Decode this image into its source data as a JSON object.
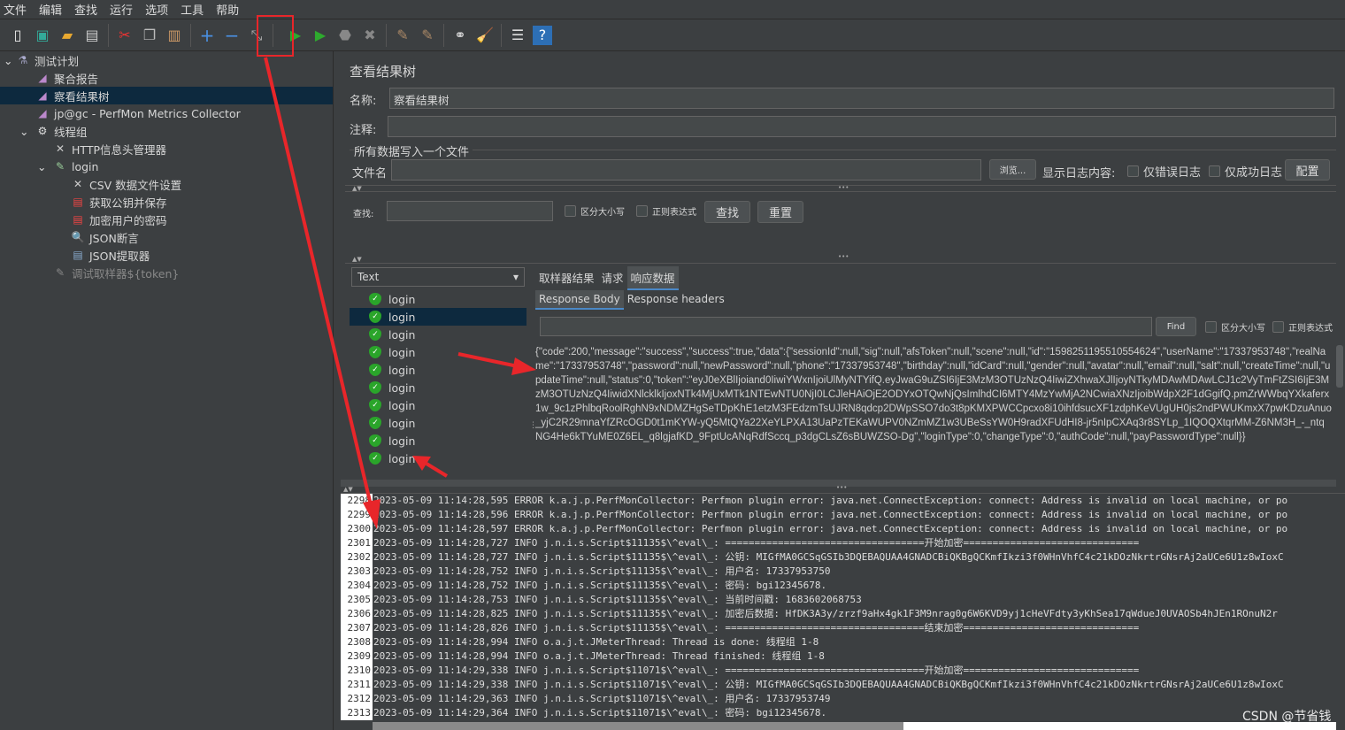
{
  "menu": [
    "文件",
    "编辑",
    "查找",
    "运行",
    "选项",
    "工具",
    "帮助"
  ],
  "toolbar": [
    "new-icon",
    "templates-icon",
    "open-icon",
    "save-icon",
    "cut-icon",
    "copy-icon",
    "paste-icon",
    "expand-icon",
    "collapse-icon",
    "toggle-icon",
    "start-icon",
    "start-no-pause-icon",
    "stop-icon",
    "shutdown-icon",
    "clear-icon",
    "clear-all-icon",
    "search-icon",
    "reset-search-icon",
    "function-helper-icon",
    "help-icon"
  ],
  "tree": {
    "items": [
      {
        "label": "测试计划",
        "icon": "test-plan-icon"
      },
      {
        "label": "聚合报告",
        "icon": "listener-icon"
      },
      {
        "label": "察看结果树",
        "icon": "listener-icon"
      },
      {
        "label": "jp@gc - PerfMon Metrics Collector",
        "icon": "listener-icon"
      },
      {
        "label": "线程组",
        "icon": "gear-icon"
      },
      {
        "label": "HTTP信息头管理器",
        "icon": "config-icon"
      },
      {
        "label": "login",
        "icon": "sampler-icon"
      },
      {
        "label": "CSV 数据文件设置",
        "icon": "config-icon"
      },
      {
        "label": "获取公钥并保存",
        "icon": "script-icon"
      },
      {
        "label": "加密用户的密码",
        "icon": "script-icon"
      },
      {
        "label": "JSON断言",
        "icon": "assertion-icon"
      },
      {
        "label": "JSON提取器",
        "icon": "extractor-icon"
      },
      {
        "label": "调试取样器${token}",
        "icon": "sampler-icon"
      }
    ]
  },
  "panel": {
    "title": "查看结果树",
    "name_label": "名称:",
    "name_value": "察看结果树",
    "comment_label": "注释:",
    "file_section": "所有数据写入一个文件",
    "filename_label": "文件名",
    "browse": "浏览...",
    "log_content_label": "显示日志内容:",
    "errors_only": "仅错误日志",
    "success_only": "仅成功日志",
    "configure": "配置",
    "search_label": "查找:",
    "case_sensitive": "区分大小写",
    "regex": "正则表达式",
    "search_btn": "查找",
    "reset_btn": "重置"
  },
  "results": {
    "renderer": "Text",
    "items": [
      "login",
      "login",
      "login",
      "login",
      "login",
      "login",
      "login",
      "login",
      "login",
      "login"
    ],
    "tabs": [
      "取样器结果",
      "请求",
      "响应数据"
    ],
    "subtabs": [
      "Response Body",
      "Response headers"
    ],
    "find_btn": "Find",
    "case_sensitive": "区分大小写",
    "regex": "正则表达式",
    "body": "{\"code\":200,\"message\":\"success\",\"success\":true,\"data\":{\"sessionId\":null,\"sig\":null,\"afsToken\":null,\"scene\":null,\"id\":\"1598251195510554624\",\"userName\":\"17337953748\",\"realName\":\"17337953748\",\"password\":null,\"newPassword\":null,\"phone\":\"17337953748\",\"birthday\":null,\"idCard\":null,\"gender\":null,\"avatar\":null,\"email\":null,\"salt\":null,\"createTime\":null,\"updateTime\":null,\"status\":0,\"token\":\"eyJ0eXBlIjoiand0IiwiYWxnIjoiUlMyNTYifQ.eyJwaG9uZSI6IjE3MzM3OTUzNzQ4IiwiZXhwaXJlIjoyNTkyMDAwMDAwLCJ1c2VyTmFtZSI6IjE3MzM3OTUzNzQ4IiwidXNlcklkIjoxNTk4MjUxMTk1NTEwNTU0NjI0LCJleHAiOjE2ODYxOTQwNjQsImlhdCI6MTY4MzYwMjA2NCwiaXNzIjoibWdpX2F1dGgifQ.pmZrWWbqYXkaferx1w_9c1zPhlbqRoolRghN9xNDMZHgSeTDpKhE1etzM3FEdzmTsUJRN8qdcp2DWpSSO7do3t8pKMXPWCCpcxo8i10ihfdsucXF1zdphKeVUgUH0js2ndPWUKmxX7pwKDzuAnuo_yjC2R29mnaYfZRcOGD0t1mKYW-yQ5MtQYa22XeYLPXA13UaPzTEKaWUPV0NZmMZ1w3UBeSsYW0H9radXFUdHI8-jr5nIpCXAq3r8SYLp_1IQOQXtqrMM-Z6NM3H_-_ntqNG4He6kTYuME0Z6EL_q8lgjafKD_9FptUcANqRdfSccq_p3dgCLsZ6sBUWZSO-Dg\",\"loginType\":0,\"changeType\":0,\"authCode\":null,\"payPasswordType\":null}}"
  },
  "log": [
    {
      "n": "2298",
      "t": "2023-05-09 11:14:28,595 ERROR k.a.j.p.PerfMonCollector: Perfmon plugin error: java.net.ConnectException: connect: Address is invalid on local machine, or po"
    },
    {
      "n": "2299",
      "t": "2023-05-09 11:14:28,596 ERROR k.a.j.p.PerfMonCollector: Perfmon plugin error: java.net.ConnectException: connect: Address is invalid on local machine, or po"
    },
    {
      "n": "2300",
      "t": "2023-05-09 11:14:28,597 ERROR k.a.j.p.PerfMonCollector: Perfmon plugin error: java.net.ConnectException: connect: Address is invalid on local machine, or po"
    },
    {
      "n": "2301",
      "t": "2023-05-09 11:14:28,727 INFO j.n.i.s.Script$11135$\\^eval\\_: ==================================开始加密=============================="
    },
    {
      "n": "2302",
      "t": "2023-05-09 11:14:28,727 INFO j.n.i.s.Script$11135$\\^eval\\_: 公钥: MIGfMA0GCSqGSIb3DQEBAQUAA4GNADCBiQKBgQCKmfIkzi3f0WHnVhfC4c21kDOzNkrtrGNsrAj2aUCe6U1z8wIoxC"
    },
    {
      "n": "2303",
      "t": "2023-05-09 11:14:28,752 INFO j.n.i.s.Script$11135$\\^eval\\_: 用户名: 17337953750"
    },
    {
      "n": "2304",
      "t": "2023-05-09 11:14:28,752 INFO j.n.i.s.Script$11135$\\^eval\\_: 密码: bgi12345678."
    },
    {
      "n": "2305",
      "t": "2023-05-09 11:14:28,753 INFO j.n.i.s.Script$11135$\\^eval\\_: 当前时间戳: 1683602068753"
    },
    {
      "n": "2306",
      "t": "2023-05-09 11:14:28,825 INFO j.n.i.s.Script$11135$\\^eval\\_: 加密后数据: HfDK3A3y/zrzf9aHx4gk1F3M9nrag0g6W6KVD9yj1cHeVFdty3yKhSea17qWdueJ0UVAOSb4hJEn1ROnuN2r"
    },
    {
      "n": "2307",
      "t": "2023-05-09 11:14:28,826 INFO j.n.i.s.Script$11135$\\^eval\\_: ==================================结束加密=============================="
    },
    {
      "n": "2308",
      "t": "2023-05-09 11:14:28,994 INFO o.a.j.t.JMeterThread: Thread is done: 线程组 1-8"
    },
    {
      "n": "2309",
      "t": "2023-05-09 11:14:28,994 INFO o.a.j.t.JMeterThread: Thread finished: 线程组 1-8"
    },
    {
      "n": "2310",
      "t": "2023-05-09 11:14:29,338 INFO j.n.i.s.Script$11071$\\^eval\\_: ==================================开始加密=============================="
    },
    {
      "n": "2311",
      "t": "2023-05-09 11:14:29,338 INFO j.n.i.s.Script$11071$\\^eval\\_: 公钥: MIGfMA0GCSqGSIb3DQEBAQUAA4GNADCBiQKBgQCKmfIkzi3f0WHnVhfC4c21kDOzNkrtrGNsrAj2aUCe6U1z8wIoxC"
    },
    {
      "n": "2312",
      "t": "2023-05-09 11:14:29,363 INFO j.n.i.s.Script$11071$\\^eval\\_: 用户名: 17337953749"
    },
    {
      "n": "2313",
      "t": "2023-05-09 11:14:29,364 INFO j.n.i.s.Script$11071$\\^eval\\_: 密码: bgi12345678."
    }
  ],
  "watermark": "CSDN @节省钱",
  "colors": {
    "bg": "#3c3f41",
    "selection": "#0d293e",
    "annotation": "#e8262a",
    "run": "#2eaa2e"
  }
}
